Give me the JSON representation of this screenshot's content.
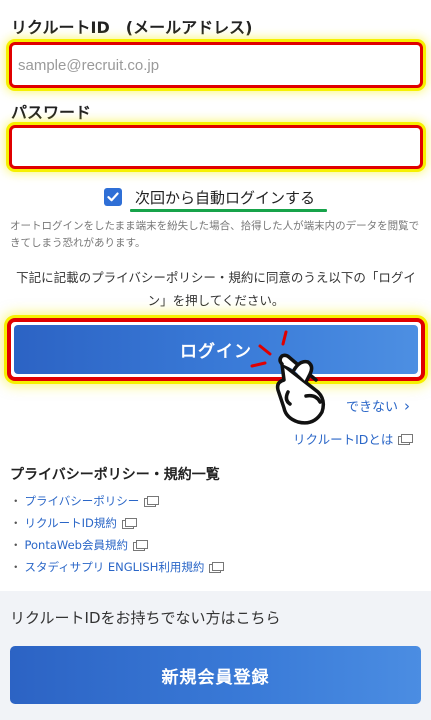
{
  "recruit_id": {
    "label": "リクルートID　(メールアドレス)",
    "placeholder": "sample@recruit.co.jp",
    "value": ""
  },
  "password": {
    "label": "パスワード",
    "value": ""
  },
  "auto_login": {
    "checked": true,
    "label": "次回から自動ログインする"
  },
  "auto_login_note": "オートログインをしたまま端末を紛失した場合、拾得した人が端末内のデータを閲覧できてしまう恐れがあります。",
  "consent_text": "下記に記載のプライバシーポリシー・規約に同意のうえ以下の「ログイン」を押してください。",
  "login_button": "ログイン",
  "trouble_link": "できない",
  "about_link": "リクルートIDとは",
  "policy": {
    "title": "プライバシーポリシー・規約一覧",
    "items": [
      "プライバシーポリシー",
      "リクルートID規約",
      "PontaWeb会員規約",
      "スタディサプリ ENGLISH利用規約"
    ]
  },
  "register": {
    "prompt": "リクルートIDをお持ちでない方はこちら",
    "button": "新規会員登録"
  },
  "colors": {
    "primary": "#2f6fd6",
    "highlight_border": "#e00000",
    "highlight_glow": "#f6f000",
    "link": "#2a66c7",
    "underline": "#17a34a"
  }
}
